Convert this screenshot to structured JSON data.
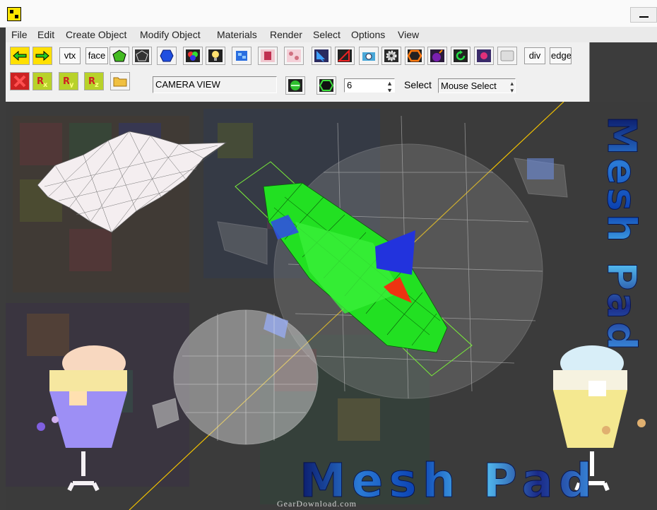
{
  "menu": [
    "File",
    "Edit",
    "Create Object",
    "Modify Object",
    "Materials",
    "Render",
    "Select",
    "Options",
    "View"
  ],
  "toolbar": {
    "vtx_label": "vtx",
    "face_label": "face",
    "div_label": "div",
    "edge_label": "edge",
    "view_name": "CAMERA VIEW",
    "sides_value": "6",
    "select_label": "Select",
    "select_mode": "Mouse Select",
    "spin_up": "▲",
    "spin_down": "▼"
  },
  "viewport": {
    "logo_bottom": "Mesh Pad",
    "logo_side": "Mesh Pad"
  },
  "watermark": "GearDownload.com",
  "colors": {
    "grid_green": "#22ee22",
    "arrow_blue": "#2233dd",
    "arrow_red": "#ee3311",
    "axis_yellow": "#f2c200",
    "logo_blue": "#1a3fb0"
  },
  "icons": [
    "arrow-left-icon",
    "arrow-right-icon",
    "green-polygon-icon",
    "wire-polygon-icon",
    "blue-hexagon-icon",
    "rgb-light-icon",
    "light-bulb-icon",
    "blue-cube-icon",
    "pink-texture-icon",
    "pink-pattern-icon",
    "select-arrow-icon",
    "triangle-icon",
    "camera-icon",
    "gear-icon",
    "orange-hexagon-icon",
    "bomb-icon",
    "rotate-icon",
    "pink-flower-icon",
    "blank-icon",
    "delete-icon",
    "rotate-x-icon",
    "rotate-y-icon",
    "rotate-z-icon",
    "folder-icon"
  ]
}
